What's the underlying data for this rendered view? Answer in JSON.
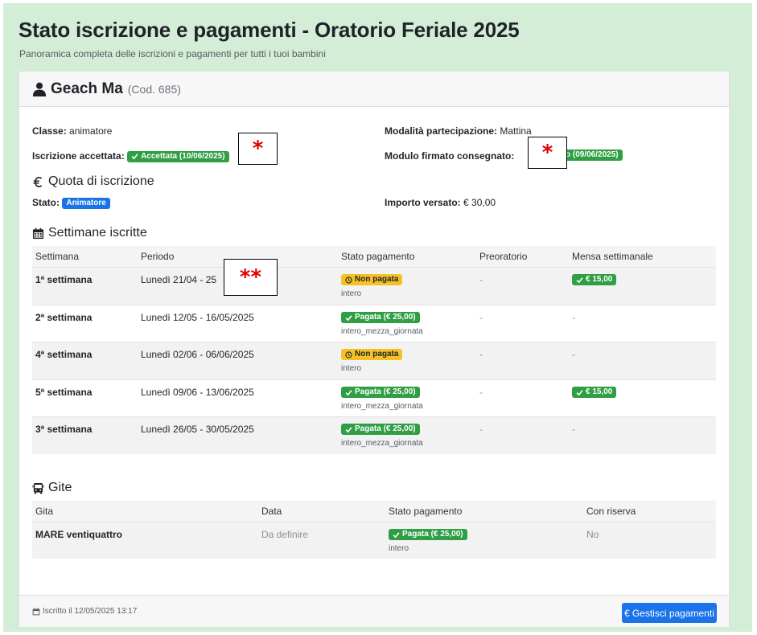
{
  "page": {
    "title": "Stato iscrizione e pagamenti - Oratorio Feriale 2025",
    "subtitle": "Panoramica completa delle iscrizioni e pagamenti per tutti i tuoi bambini"
  },
  "child": {
    "name": "Geach Ma",
    "code": "(Cod. 685)"
  },
  "info": {
    "class_label": "Classe:",
    "class_value": "animatore",
    "mode_label": "Modalità partecipazione:",
    "mode_value": "Mattina",
    "accepted_label": "Iscrizione accettata:",
    "accepted_badge": "Accettata (10/06/2025)",
    "form_label": "Modulo firmato consegnato:",
    "form_badge": "o (09/06/2025)"
  },
  "fee": {
    "title": "Quota di iscrizione",
    "status_label": "Stato:",
    "status_badge": "Animatore",
    "paid_label": "Importo versato:",
    "paid_value": "€ 30,00"
  },
  "weeks": {
    "title": "Settimane iscritte",
    "headers": [
      "Settimana",
      "Periodo",
      "Stato pagamento",
      "Preoratorio",
      "Mensa settimanale"
    ],
    "rows": [
      {
        "week": "1ª settimana",
        "period": "Lunedì 21/04 - 25",
        "status": "Non pagata",
        "status_type": "warning",
        "detail": "intero",
        "pre": "-",
        "meal": "€ 15,00"
      },
      {
        "week": "2ª settimana",
        "period": "Lunedì 12/05 - 16/05/2025",
        "status": "Pagata (€ 25,00)",
        "status_type": "success",
        "detail": "intero_mezza_giornata",
        "pre": "-",
        "meal": "-"
      },
      {
        "week": "4ª settimana",
        "period": "Lunedì 02/06 - 06/06/2025",
        "status": "Non pagata",
        "status_type": "warning",
        "detail": "intero",
        "pre": "-",
        "meal": "-"
      },
      {
        "week": "5ª settimana",
        "period": "Lunedì 09/06 - 13/06/2025",
        "status": "Pagata (€ 25,00)",
        "status_type": "success",
        "detail": "intero_mezza_giornata",
        "pre": "-",
        "meal": "€ 15,00"
      },
      {
        "week": "3ª settimana",
        "period": "Lunedì 26/05 - 30/05/2025",
        "status": "Pagata (€ 25,00)",
        "status_type": "success",
        "detail": "intero_mezza_giornata",
        "pre": "-",
        "meal": "-"
      }
    ]
  },
  "trips": {
    "title": "Gite",
    "headers": [
      "Gita",
      "Data",
      "Stato pagamento",
      "Con riserva"
    ],
    "rows": [
      {
        "name": "MARE ventiquattro",
        "date": "Da definire",
        "status": "Pagata (€ 25,00)",
        "detail": "intero",
        "reserve": "No"
      }
    ]
  },
  "footer": {
    "registered": "Iscritto il 12/05/2025 13:17",
    "manage_button": "Gestisci pagamenti"
  },
  "redactions": {
    "single": "*",
    "double": "**"
  },
  "colors": {
    "page_bg": "#d4edd7",
    "success": "#2f9e44",
    "warning": "#f5c125",
    "primary": "#1a73e8",
    "redaction": "#e00000"
  },
  "icons": {
    "header": "user-icon",
    "fee": "euro-icon",
    "weeks": "calendar-icon",
    "trips": "bus-icon",
    "badge_check": "check-icon",
    "badge_pending": "clock-icon",
    "footer": "calendar-icon",
    "button": "euro-icon"
  }
}
